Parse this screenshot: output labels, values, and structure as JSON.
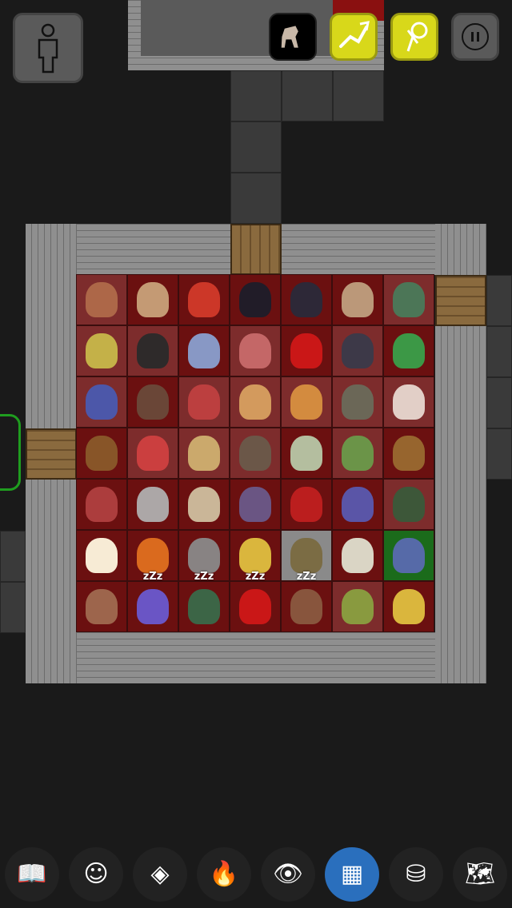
{
  "top_bar": {
    "character_button": "character-icon",
    "horse_button": "horse-icon",
    "attack_button": "sword-arm-icon",
    "carry_button": "carry-sack-icon",
    "pause_button": "pause-icon"
  },
  "grid": {
    "rows": [
      [
        {
          "m": "hooded-wizard",
          "tone": "light",
          "color": "#b06a4a"
        },
        {
          "m": "centaur",
          "tone": "dark",
          "color": "#c9a27a"
        },
        {
          "m": "red-winged-demon",
          "tone": "dark",
          "color": "#d23a2a"
        },
        {
          "m": "black-panther",
          "tone": "dark",
          "color": "#1e1e2a"
        },
        {
          "m": "black-bat",
          "tone": "dark",
          "color": "#2a2a3a"
        },
        {
          "m": "roman-soldier",
          "tone": "dark",
          "color": "#c0a080"
        },
        {
          "m": "cloaked-goblin",
          "tone": "light",
          "color": "#4a7a5a"
        }
      ],
      [
        {
          "m": "gold-pile",
          "tone": "light",
          "color": "#c8b84a"
        },
        {
          "m": "black-knight",
          "tone": "light",
          "color": "#2a2a2a"
        },
        {
          "m": "skeleton-mage",
          "tone": "dark",
          "color": "#8aa0d0"
        },
        {
          "m": "flayed-man",
          "tone": "light",
          "color": "#c86a6a"
        },
        {
          "m": "ladybug",
          "tone": "dark",
          "color": "#d01818"
        },
        {
          "m": "robed-rat",
          "tone": "light",
          "color": "#3a3a4a"
        },
        {
          "m": "green-dragon",
          "tone": "dark",
          "color": "#3aa04a"
        }
      ],
      [
        {
          "m": "dwarf",
          "tone": "light",
          "color": "#4a5ab0"
        },
        {
          "m": "brown-spider",
          "tone": "dark",
          "color": "#6a4a3a"
        },
        {
          "m": "gladiator",
          "tone": "light",
          "color": "#c04040"
        },
        {
          "m": "orange-cat",
          "tone": "light",
          "color": "#d8a060"
        },
        {
          "m": "orange-cat-sitting",
          "tone": "light",
          "color": "#d89040"
        },
        {
          "m": "troll",
          "tone": "light",
          "color": "#6a6a5a"
        },
        {
          "m": "nurse",
          "tone": "light",
          "color": "#e8d8d0"
        }
      ],
      [
        {
          "m": "brown-horse",
          "tone": "dark",
          "color": "#8a5a2a"
        },
        {
          "m": "red-blob",
          "tone": "light",
          "color": "#d04040"
        },
        {
          "m": "golden-dog",
          "tone": "light",
          "color": "#d0b070"
        },
        {
          "m": "armored-dwarf",
          "tone": "light",
          "color": "#6a5a4a"
        },
        {
          "m": "pale-serpent",
          "tone": "dark",
          "color": "#b8c8a8"
        },
        {
          "m": "green-ogre",
          "tone": "light",
          "color": "#6a9a4a"
        },
        {
          "m": "brown-beast",
          "tone": "dark",
          "color": "#9a6a30"
        }
      ],
      [
        {
          "m": "red-spider",
          "tone": "dark",
          "color": "#b04040"
        },
        {
          "m": "grey-cloud",
          "tone": "dark",
          "color": "#b0b0b0"
        },
        {
          "m": "mummy",
          "tone": "dark",
          "color": "#d0c0a0"
        },
        {
          "m": "axe-warrior",
          "tone": "dark",
          "color": "#6a5a8a"
        },
        {
          "m": "winged-devil",
          "tone": "dark",
          "color": "#c02020"
        },
        {
          "m": "blue-wolf",
          "tone": "dark",
          "color": "#5a5ab0"
        },
        {
          "m": "green-ghoul",
          "tone": "light",
          "color": "#3a5a3a"
        }
      ],
      [
        {
          "m": "light-orb",
          "tone": "dark",
          "color": "#fff8e0"
        },
        {
          "m": "fire-imp",
          "tone": "dark",
          "color": "#e07020"
        },
        {
          "m": "grey-rat",
          "tone": "dark",
          "color": "#8a8a8a"
        },
        {
          "m": "giant-bee",
          "tone": "dark",
          "color": "#e0c040"
        },
        {
          "m": "rock-sack",
          "tone": "grey",
          "color": "#7a6a40"
        },
        {
          "m": "flower-sprite",
          "tone": "dark",
          "color": "#e0e0d0"
        },
        {
          "m": "sorceress",
          "tone": "green",
          "color": "#5a6ab0"
        }
      ],
      [
        {
          "m": "brown-bat",
          "tone": "dark",
          "color": "#a06a50"
        },
        {
          "m": "plasma-orb",
          "tone": "dark",
          "color": "#6a5ad0",
          "zzz": "zZz"
        },
        {
          "m": "green-kobold",
          "tone": "dark",
          "color": "#3a6a4a",
          "zzz": "zZz"
        },
        {
          "m": "ladybug",
          "tone": "dark",
          "color": "#d01818",
          "zzz": "zZz"
        },
        {
          "m": "brown-spider",
          "tone": "dark",
          "color": "#8a5a40",
          "zzz": "zZz"
        },
        {
          "m": "goblin-imp",
          "tone": "light",
          "color": "#8aa040"
        },
        {
          "m": "giant-bee",
          "tone": "dark",
          "color": "#e0c040"
        }
      ]
    ]
  },
  "bottom_bar": [
    {
      "icon": "spellbook-icon",
      "active": false
    },
    {
      "icon": "head-icon",
      "active": false
    },
    {
      "icon": "diamond-sign-icon",
      "active": false
    },
    {
      "icon": "campfire-icon",
      "active": false
    },
    {
      "icon": "eye-icon",
      "active": false
    },
    {
      "icon": "floor-tiles-icon",
      "active": true
    },
    {
      "icon": "inventory-icon",
      "active": false
    },
    {
      "icon": "map-icon",
      "active": false
    }
  ]
}
